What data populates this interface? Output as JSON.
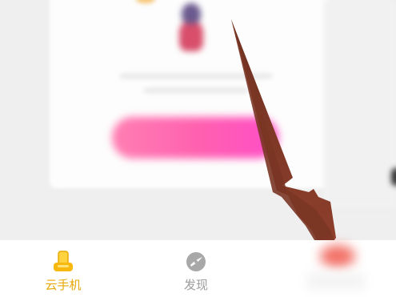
{
  "tabbar": {
    "items": [
      {
        "label": "云手机",
        "icon": "phone-cloud-icon",
        "active": true,
        "color": "#e8a908"
      },
      {
        "label": "发现",
        "icon": "compass-discover-icon",
        "active": false,
        "color": "#9c9c9c"
      },
      {
        "label": "",
        "icon": "profile-icon",
        "active": false
      }
    ]
  },
  "banner": {
    "button_color": "#ff5fb0"
  },
  "annotation": {
    "arrow_color": "#8b3a2b"
  }
}
